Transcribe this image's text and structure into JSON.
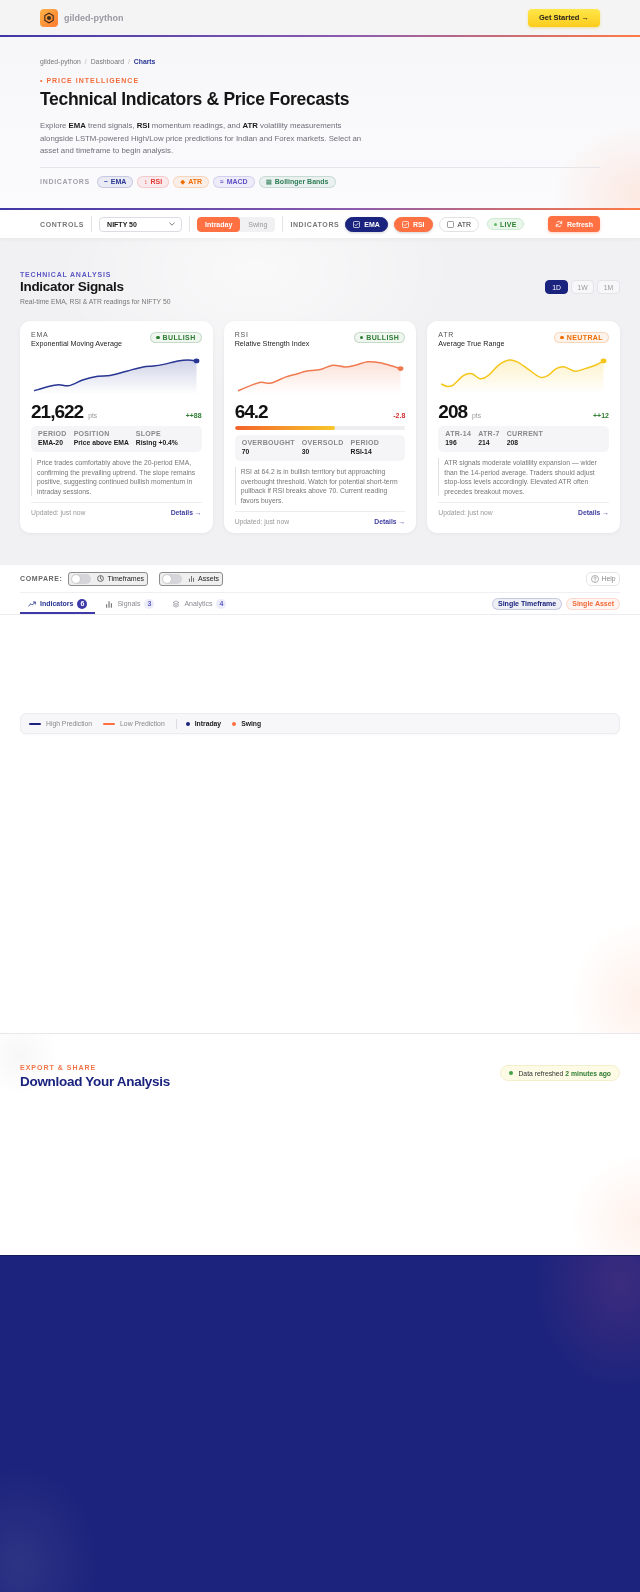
{
  "nav": {
    "brand": "gilded-python",
    "cta": "Get Started →"
  },
  "hero": {
    "breadcrumb": {
      "separator": "/",
      "items": [
        {
          "label": "gilded-python",
          "current": false
        },
        {
          "label": "Dashboard",
          "current": false
        },
        {
          "label": "Charts",
          "current": true
        }
      ]
    },
    "eyebrow": "• PRICE INTELLIGENCE",
    "title": "Technical Indicators & Price Forecasts",
    "description": "Explore **EMA** trend signals, **RSI** momentum readings, and **ATR** volatility measurements alongside LSTM-powered High/Low price predictions for Indian and Forex markets. Select an asset and timeframe to begin analysis.",
    "indicators_label": "INDICATORS",
    "chips": [
      {
        "icon": "~",
        "label": "EMA",
        "color": "#283593"
      },
      {
        "icon": "↕",
        "label": "RSI",
        "color": "#e53935"
      },
      {
        "icon": "◆",
        "label": "ATR",
        "color": "#ef6c00"
      },
      {
        "icon": "≈",
        "label": "MACD",
        "color": "#5e4fc6"
      },
      {
        "icon": "▦",
        "label": "Bollinger Bands",
        "color": "#2e7d57"
      }
    ]
  },
  "controls": {
    "label": "CONTROLS",
    "asset": {
      "value": "NIFTY 50"
    },
    "modes": [
      {
        "label": "Intraday",
        "selected": true
      },
      {
        "label": "Swing",
        "selected": false
      }
    ],
    "indicators_label": "INDICATORS",
    "toggles": [
      {
        "label": "EMA",
        "checked": true,
        "color": "#1a237e"
      },
      {
        "label": "RSI",
        "checked": true,
        "color": "#ff7043"
      },
      {
        "label": "ATR",
        "checked": false
      }
    ],
    "live": "LIVE",
    "refresh": "Refresh"
  },
  "signals": {
    "eyebrow": "TECHNICAL ANALYSIS",
    "title": "Indicator Signals",
    "subtitle": "Real-time EMA, RSI & ATR readings for NIFTY 50",
    "ranges": [
      {
        "label": "1D",
        "selected": true
      },
      {
        "label": "1W",
        "selected": false
      },
      {
        "label": "1M",
        "selected": false
      }
    ],
    "cards": [
      {
        "code": "EMA",
        "name": "Exponential Moving Average",
        "signal": {
          "label": "BULLISH",
          "color": "#2e7d32"
        },
        "color": "#283593",
        "value": "21,622",
        "unit": "pts",
        "change": {
          "text": "++88",
          "negative": false
        },
        "stats": [
          {
            "label": "PERIOD",
            "value": "EMA-20"
          },
          {
            "label": "POSITION",
            "value": "Price above EMA"
          },
          {
            "label": "SLOPE",
            "value": "Rising +0.4%"
          }
        ],
        "note": "Price trades comfortably above the 20-period EMA, confirming the prevailing uptrend. The slope remains positive, suggesting continued bullish momentum in intraday sessions.",
        "updated": "Updated: just now",
        "details": "Details →"
      },
      {
        "code": "RSI",
        "name": "Relative Strength Index",
        "signal": {
          "label": "BULLISH",
          "color": "#2e7d32"
        },
        "color": "#f07a50",
        "value": "64.2",
        "change": {
          "text": "-2.8",
          "negative": true
        },
        "gauge": {
          "level": 0.59
        },
        "stats": [
          {
            "label": "OVERBOUGHT",
            "value": "70"
          },
          {
            "label": "OVERSOLD",
            "value": "30"
          },
          {
            "label": "PERIOD",
            "value": "RSI-14"
          }
        ],
        "note": "RSI at 64.2 is in bullish territory but approaching overbought threshold. Watch for potential short-term pullback if RSI breaks above 70. Current reading favors buyers.",
        "updated": "Updated: just now",
        "details": "Details →"
      },
      {
        "code": "ATR",
        "name": "Average True Range",
        "signal": {
          "label": "NEUTRAL",
          "color": "#ef6c00"
        },
        "color": "#f5c518",
        "value": "208",
        "unit": "pts",
        "change": {
          "text": "++12",
          "negative": false
        },
        "stats": [
          {
            "label": "ATR-14",
            "value": "196"
          },
          {
            "label": "ATR-7",
            "value": "214"
          },
          {
            "label": "CURRENT",
            "value": "208"
          }
        ],
        "note": "ATR signals moderate volatility expansion — wider than the 14-period average. Traders should adjust stop-loss levels accordingly. Elevated ATR often precedes breakout moves.",
        "updated": "Updated: just now",
        "details": "Details →"
      }
    ]
  },
  "compare": {
    "label": "COMPARE:",
    "toggles": [
      {
        "label": "Timeframes",
        "on": false
      },
      {
        "label": "Assets",
        "on": false
      }
    ],
    "help": "Help",
    "tabs": [
      {
        "label": "Indicators",
        "count": "6",
        "selected": true
      },
      {
        "label": "Signals",
        "count": "3",
        "selected": false
      },
      {
        "label": "Analytics",
        "count": "4",
        "selected": false
      }
    ],
    "tags": [
      {
        "label": "Single Timeframe",
        "color": "#1a237e"
      },
      {
        "label": "Single Asset",
        "color": "#f4693a"
      }
    ]
  },
  "legend": {
    "items": [
      {
        "kind": "line",
        "label": "High Prediction",
        "color": "#1a237e"
      },
      {
        "kind": "line",
        "label": "Low Prediction",
        "color": "#ff7043"
      },
      {
        "kind": "dot",
        "label": "Intraday",
        "color": "#1a237e"
      },
      {
        "kind": "dot",
        "label": "Swing",
        "color": "#ff7043"
      }
    ]
  },
  "export": {
    "eyebrow": "EXPORT & SHARE",
    "title": "Download Your Analysis",
    "status": "Data refreshed **2 minutes ago**"
  }
}
